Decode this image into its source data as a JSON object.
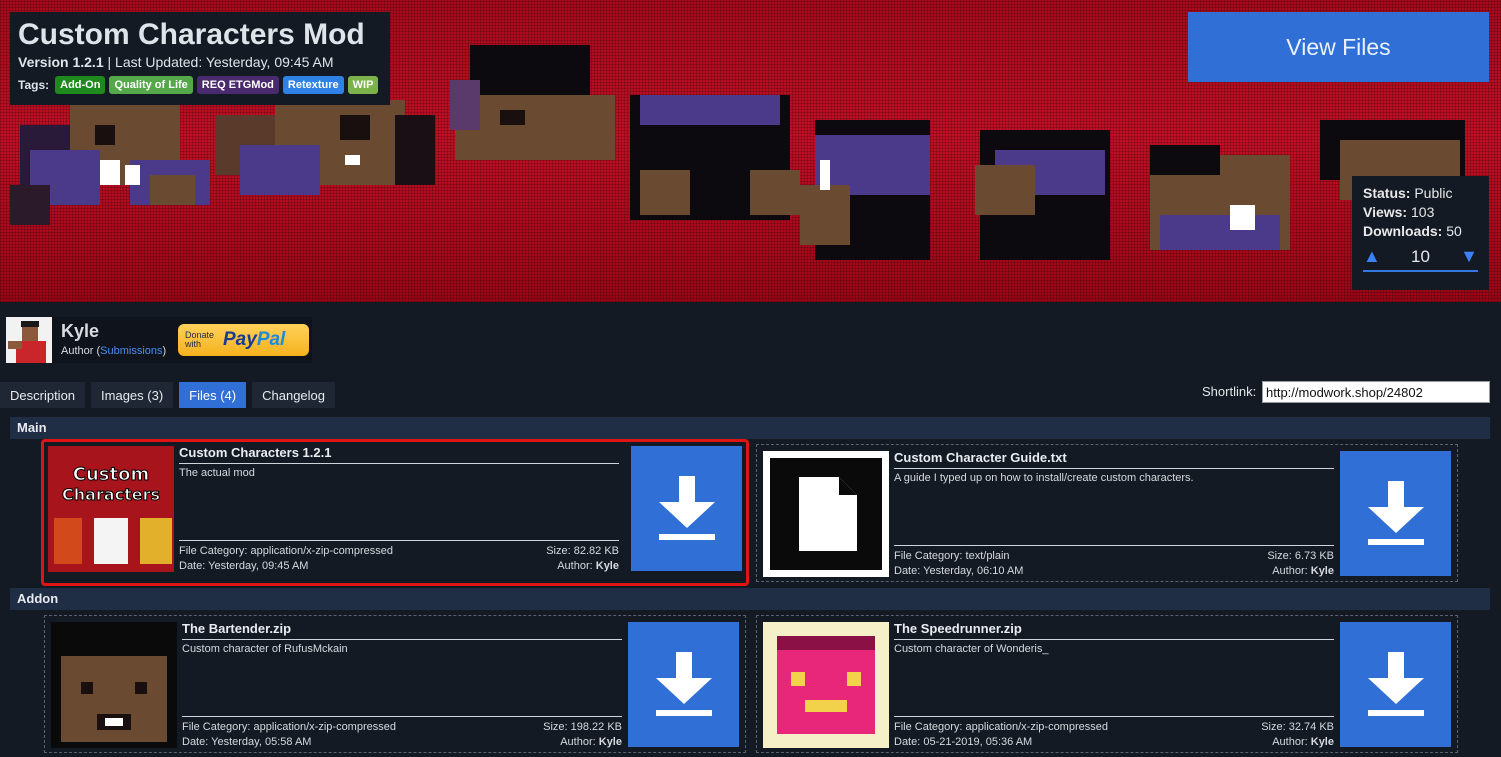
{
  "header": {
    "title": "Custom Characters Mod",
    "version_label": "Version 1.2.1",
    "last_updated": "Last Updated: Yesterday, 09:45 AM",
    "tags_label": "Tags:",
    "tags": [
      {
        "label": "Add-On",
        "color": "#1e8a1e"
      },
      {
        "label": "Quality of Life",
        "color": "#55a84a"
      },
      {
        "label": "REQ ETGMod",
        "color": "#4a2a6e"
      },
      {
        "label": "Retexture",
        "color": "#2e82e6"
      },
      {
        "label": "WIP",
        "color": "#7bb34a"
      }
    ],
    "view_files_label": "View Files"
  },
  "stats": {
    "status_label": "Status:",
    "status_value": "Public",
    "views_label": "Views:",
    "views_value": "103",
    "downloads_label": "Downloads:",
    "downloads_value": "50",
    "vote_count": "10"
  },
  "author": {
    "name": "Kyle",
    "role": "Author",
    "submissions_link": "Submissions",
    "donate_text_1": "Donate",
    "donate_text_2": "with",
    "paypal_1": "Pay",
    "paypal_2": "Pal"
  },
  "tabs": [
    {
      "label": "Description",
      "active": false
    },
    {
      "label": "Images (3)",
      "active": false
    },
    {
      "label": "Files (4)",
      "active": true
    },
    {
      "label": "Changelog",
      "active": false
    }
  ],
  "shortlink": {
    "label": "Shortlink:",
    "value": "http://modwork.shop/24802"
  },
  "sections": [
    {
      "title": "Main",
      "files": [
        {
          "name": "Custom Characters 1.2.1",
          "description": "The actual mod",
          "category": "File Category: application/x-zip-compressed",
          "size": "Size: 82.82 KB",
          "date": "Date: Yesterday, 09:45 AM",
          "author_label": "Author:",
          "author": "Kyle",
          "thumb_text_1": "Custom",
          "thumb_text_2": "Characters"
        },
        {
          "name": "Custom Character Guide.txt",
          "description": "A guide I typed up on how to install/create custom characters.",
          "category": "File Category: text/plain",
          "size": "Size: 6.73 KB",
          "date": "Date: Yesterday, 06:10 AM",
          "author_label": "Author:",
          "author": "Kyle"
        }
      ]
    },
    {
      "title": "Addon",
      "files": [
        {
          "name": "The Bartender.zip",
          "description": "Custom character of RufusMckain",
          "category": "File Category: application/x-zip-compressed",
          "size": "Size: 198.22 KB",
          "date": "Date: Yesterday, 05:58 AM",
          "author_label": "Author:",
          "author": "Kyle"
        },
        {
          "name": "The Speedrunner.zip",
          "description": "Custom character of Wonderis_",
          "category": "File Category: application/x-zip-compressed",
          "size": "Size: 32.74 KB",
          "date": "Date: 05-21-2019, 05:36 AM",
          "author_label": "Author:",
          "author": "Kyle"
        }
      ]
    }
  ],
  "icons": [
    "arrow-up-icon",
    "arrow-down-icon",
    "download-icon",
    "document-icon"
  ]
}
